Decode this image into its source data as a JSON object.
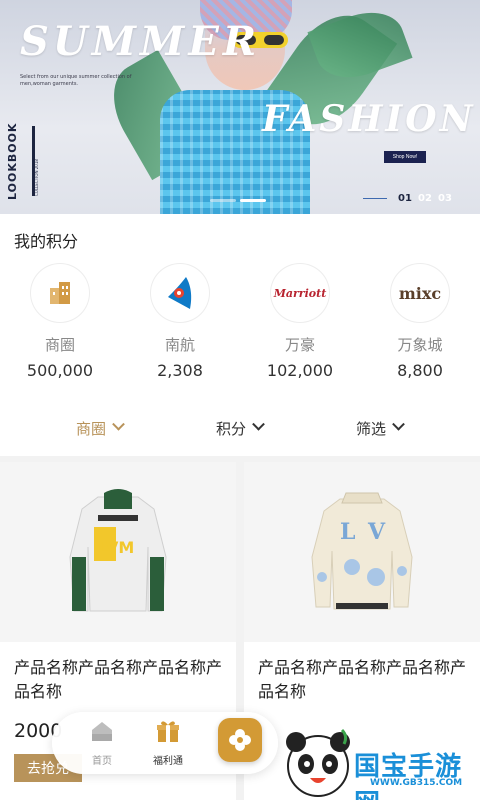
{
  "banner": {
    "headline_1": "SUMMER",
    "headline_2": "FASHION",
    "description": "Select from our unique summer collection of men,woman garments.",
    "side_title": "LOOKBOOK",
    "side_subtitle": "COLLECTION 2018",
    "cta_label": "Shop Now!",
    "pages": [
      "01",
      "02",
      "03"
    ],
    "active_page": "01"
  },
  "points": {
    "title": "我的积分",
    "items": [
      {
        "name": "商圈",
        "value": "500,000",
        "icon": "building-icon"
      },
      {
        "name": "南航",
        "value": "2,308",
        "icon": "china-southern-logo"
      },
      {
        "name": "万豪",
        "value": "102,000",
        "icon": "marriott-logo",
        "logo_text": "Marriott"
      },
      {
        "name": "万象城",
        "value": "8,800",
        "icon": "mixc-logo",
        "logo_text": "mixc"
      }
    ]
  },
  "filters": [
    {
      "label": "商圈",
      "active": true
    },
    {
      "label": "积分",
      "active": false
    },
    {
      "label": "筛选",
      "active": false
    }
  ],
  "products": [
    {
      "name": "产品名称产品名称产品名称产品名称",
      "price": "2000",
      "buy_label": "去抢兑",
      "image": "hooded-jacket-image"
    },
    {
      "name": "产品名称产品名称产品名称产品名称",
      "price": "",
      "buy_label": "",
      "image": "varsity-jacket-image"
    }
  ],
  "tabbar": {
    "items": [
      {
        "label": "首页",
        "icon": "home-icon"
      },
      {
        "label": "福利通",
        "icon": "gift-icon"
      }
    ]
  },
  "watermark": {
    "text": "国宝手游网",
    "url": "WWW.GB315.COM"
  },
  "colors": {
    "accent_gold": "#b8935a",
    "fab_orange": "#d39a35",
    "shop_now_navy": "#1b2250",
    "watermark_blue": "#1a8fd8"
  }
}
